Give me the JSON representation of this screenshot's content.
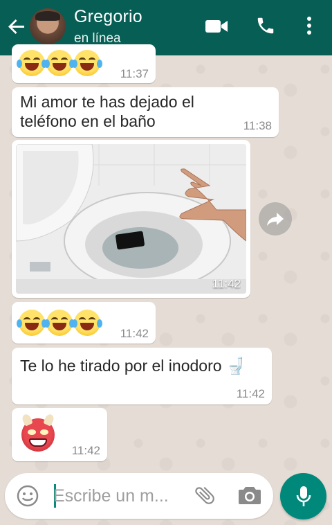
{
  "header": {
    "contact_name": "Gregorio",
    "status": "en línea",
    "icons": [
      "back-arrow-icon",
      "video-call-icon",
      "phone-icon",
      "more-vert-icon"
    ],
    "color": "#075e54"
  },
  "messages": [
    {
      "type": "emoji",
      "emoji": "😂😂😂",
      "time": "11:37"
    },
    {
      "type": "text",
      "lines": [
        "Mi amor te has dejado el",
        "teléfono en el baño"
      ],
      "time": "11:38"
    },
    {
      "type": "image",
      "description_icon": "photo",
      "time": "11:42"
    },
    {
      "type": "emoji",
      "emoji": "😂😂😂",
      "time": "11:42"
    },
    {
      "type": "text",
      "lines": [
        "Te lo he tirado por el inodoro 🚽"
      ],
      "time": "11:42"
    },
    {
      "type": "emoji",
      "emoji": "👹",
      "time": "11:42"
    }
  ],
  "composer": {
    "placeholder": "Escribe un m...",
    "icons": [
      "emoji-icon",
      "attach-icon",
      "camera-icon",
      "mic-icon"
    ],
    "accent": "#00897b"
  }
}
